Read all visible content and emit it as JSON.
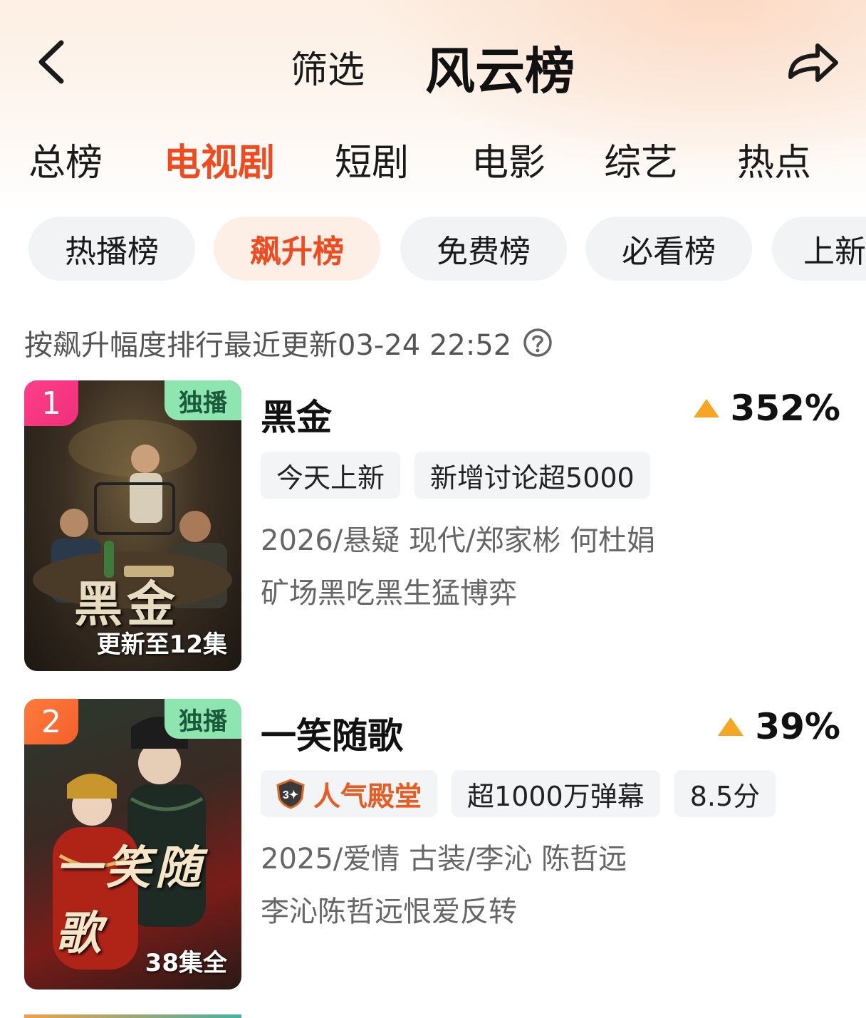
{
  "header": {
    "filter_label": "筛选",
    "title": "风云榜",
    "back_icon": "chevron-left-icon",
    "share_icon": "share-arrow-icon"
  },
  "categories": [
    {
      "label": "总榜"
    },
    {
      "label": "电视剧",
      "active": true
    },
    {
      "label": "短剧"
    },
    {
      "label": "电影"
    },
    {
      "label": "综艺"
    },
    {
      "label": "热点"
    }
  ],
  "sub_tabs": [
    {
      "label": "热播榜"
    },
    {
      "label": "飙升榜",
      "active": true
    },
    {
      "label": "免费榜"
    },
    {
      "label": "必看榜"
    },
    {
      "label": "上新"
    }
  ],
  "update_info": {
    "text": "按飙升幅度排行最近更新03-24 22:52",
    "icon": "help-circle-icon"
  },
  "items": [
    {
      "rank": "1",
      "exclusive": "独播",
      "poster_title": "黑金",
      "episode_label": "更新至12集",
      "title": "黑金",
      "heat": "352%",
      "tags": [
        "今天上新",
        "新增讨论超5000"
      ],
      "meta": "2026/悬疑 现代/郑家彬 何杜娟",
      "desc": "矿场黑吃黑生猛博弈"
    },
    {
      "rank": "2",
      "exclusive": "独播",
      "poster_title": "一笑随歌",
      "episode_label": "38集全",
      "title": "一笑随歌",
      "heat": "39%",
      "hall_tag": "人气殿堂",
      "tags": [
        "超1000万弹幕",
        "8.5分"
      ],
      "meta": "2025/爱情 古装/李沁 陈哲远",
      "desc": "李沁陈哲远恨爱反转"
    }
  ],
  "colors": {
    "accent": "#f04a1f",
    "rank1": "#f0307a",
    "rank2": "#f4602a",
    "exclusive_bg": "#8fe5b0",
    "heat_arrow": "#f5a623"
  }
}
